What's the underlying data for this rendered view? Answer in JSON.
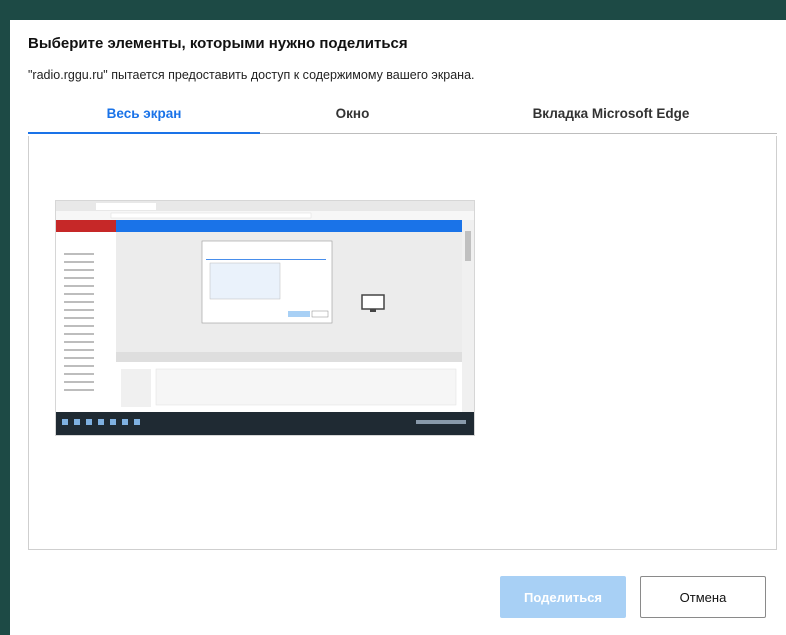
{
  "dialog": {
    "title": "Выберите элементы, которыми нужно поделиться",
    "subtitle": "\"radio.rggu.ru\" пытается предоставить доступ к содержимому вашего экрана."
  },
  "tabs": [
    {
      "label": "Весь экран",
      "active": true
    },
    {
      "label": "Окно",
      "active": false
    },
    {
      "label": "Вкладка Microsoft Edge",
      "active": false
    }
  ],
  "buttons": {
    "share_label": "Поделиться",
    "share_enabled": false,
    "cancel_label": "Отмена"
  },
  "colors": {
    "background": "#1d4a45",
    "accent": "#1a73e8",
    "share_disabled": "#a8d0f5"
  }
}
